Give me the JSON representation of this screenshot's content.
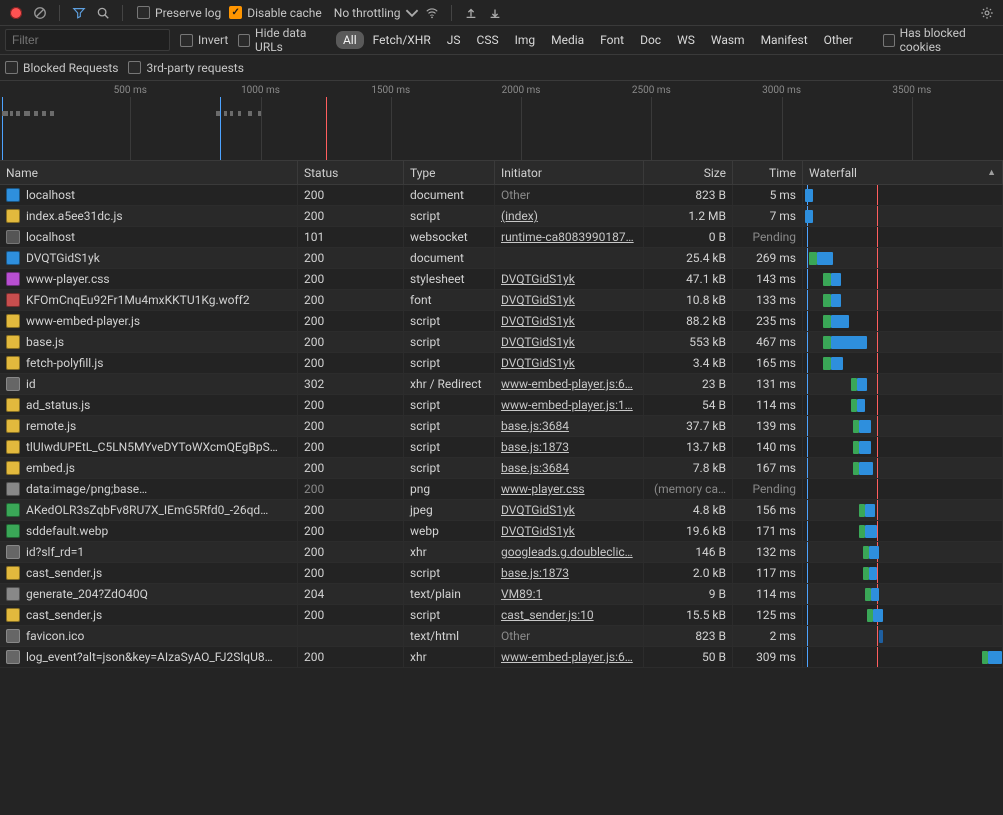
{
  "toolbar": {
    "preserve_log_label": "Preserve log",
    "disable_cache_label": "Disable cache",
    "throttling_label": "No throttling"
  },
  "filterbar": {
    "filter_placeholder": "Filter",
    "invert_label": "Invert",
    "hide_data_urls_label": "Hide data URLs",
    "categories": [
      "All",
      "Fetch/XHR",
      "JS",
      "CSS",
      "Img",
      "Media",
      "Font",
      "Doc",
      "WS",
      "Wasm",
      "Manifest",
      "Other"
    ],
    "has_blocked_cookies_label": "Has blocked cookies"
  },
  "filterbar2": {
    "blocked_requests_label": "Blocked Requests",
    "third_party_label": "3rd-party requests"
  },
  "timeline": {
    "ticks": [
      "500 ms",
      "1000 ms",
      "1500 ms",
      "2000 ms",
      "2500 ms",
      "3000 ms",
      "3500 ms"
    ]
  },
  "columns": {
    "name": "Name",
    "status": "Status",
    "type": "Type",
    "initiator": "Initiator",
    "size": "Size",
    "time": "Time",
    "waterfall": "Waterfall"
  },
  "rows": [
    {
      "icon": "doc",
      "name": "localhost",
      "status": "200",
      "type": "document",
      "initiator": "Other",
      "init_dim": true,
      "size": "823 B",
      "time": "5 ms",
      "wf": [
        {
          "l": 1,
          "w": 4,
          "c": "b"
        }
      ]
    },
    {
      "icon": "js",
      "name": "index.a5ee31dc.js",
      "status": "200",
      "type": "script",
      "initiator": "(index)",
      "size": "1.2 MB",
      "time": "7 ms",
      "wf": [
        {
          "l": 1,
          "w": 4,
          "c": "b"
        }
      ]
    },
    {
      "icon": "ws",
      "name": "localhost",
      "status": "101",
      "type": "websocket",
      "initiator": "runtime-ca8083990187…",
      "size": "0 B",
      "time": "Pending",
      "wf": []
    },
    {
      "icon": "doc",
      "name": "DVQTGidS1yk",
      "status": "200",
      "type": "document",
      "initiator": "",
      "init_dim": true,
      "size": "25.4 kB",
      "time": "269 ms",
      "wf": [
        {
          "l": 3,
          "w": 4,
          "c": "g"
        },
        {
          "l": 7,
          "w": 8,
          "c": "b"
        }
      ]
    },
    {
      "icon": "css",
      "name": "www-player.css",
      "status": "200",
      "type": "stylesheet",
      "initiator": "DVQTGidS1yk",
      "size": "47.1 kB",
      "time": "143 ms",
      "wf": [
        {
          "l": 10,
          "w": 4,
          "c": "g"
        },
        {
          "l": 14,
          "w": 5,
          "c": "b"
        }
      ]
    },
    {
      "icon": "font",
      "name": "KFOmCnqEu92Fr1Mu4mxKKTU1Kg.woff2",
      "status": "200",
      "type": "font",
      "initiator": "DVQTGidS1yk",
      "size": "10.8 kB",
      "time": "133 ms",
      "wf": [
        {
          "l": 10,
          "w": 4,
          "c": "g"
        },
        {
          "l": 14,
          "w": 5,
          "c": "b"
        }
      ]
    },
    {
      "icon": "js",
      "name": "www-embed-player.js",
      "status": "200",
      "type": "script",
      "initiator": "DVQTGidS1yk",
      "size": "88.2 kB",
      "time": "235 ms",
      "wf": [
        {
          "l": 10,
          "w": 4,
          "c": "g"
        },
        {
          "l": 14,
          "w": 9,
          "c": "b"
        }
      ]
    },
    {
      "icon": "js",
      "name": "base.js",
      "status": "200",
      "type": "script",
      "initiator": "DVQTGidS1yk",
      "size": "553 kB",
      "time": "467 ms",
      "wf": [
        {
          "l": 10,
          "w": 4,
          "c": "g"
        },
        {
          "l": 14,
          "w": 18,
          "c": "b"
        }
      ]
    },
    {
      "icon": "js",
      "name": "fetch-polyfill.js",
      "status": "200",
      "type": "script",
      "initiator": "DVQTGidS1yk",
      "size": "3.4 kB",
      "time": "165 ms",
      "wf": [
        {
          "l": 10,
          "w": 4,
          "c": "g"
        },
        {
          "l": 14,
          "w": 6,
          "c": "b"
        }
      ]
    },
    {
      "icon": "xhr",
      "name": "id",
      "status": "302",
      "type": "xhr / Redirect",
      "initiator": "www-embed-player.js:6…",
      "size": "23 B",
      "time": "131 ms",
      "wf": [
        {
          "l": 24,
          "w": 3,
          "c": "g"
        },
        {
          "l": 27,
          "w": 5,
          "c": "b"
        }
      ]
    },
    {
      "icon": "js",
      "name": "ad_status.js",
      "status": "200",
      "type": "script",
      "initiator": "www-embed-player.js:1…",
      "size": "54 B",
      "time": "114 ms",
      "wf": [
        {
          "l": 24,
          "w": 3,
          "c": "g"
        },
        {
          "l": 27,
          "w": 4,
          "c": "b"
        }
      ]
    },
    {
      "icon": "js",
      "name": "remote.js",
      "status": "200",
      "type": "script",
      "initiator": "base.js:3684",
      "size": "37.7 kB",
      "time": "139 ms",
      "wf": [
        {
          "l": 25,
          "w": 3,
          "c": "g"
        },
        {
          "l": 28,
          "w": 6,
          "c": "b"
        }
      ]
    },
    {
      "icon": "js",
      "name": "tlUIwdUPEtL_C5LN5MYveDYToWXcmQEgBpS…",
      "status": "200",
      "type": "script",
      "initiator": "base.js:1873",
      "size": "13.7 kB",
      "time": "140 ms",
      "wf": [
        {
          "l": 25,
          "w": 3,
          "c": "g"
        },
        {
          "l": 28,
          "w": 6,
          "c": "b"
        }
      ]
    },
    {
      "icon": "js",
      "name": "embed.js",
      "status": "200",
      "type": "script",
      "initiator": "base.js:3684",
      "size": "7.8 kB",
      "time": "167 ms",
      "wf": [
        {
          "l": 25,
          "w": 3,
          "c": "g"
        },
        {
          "l": 28,
          "w": 7,
          "c": "b"
        }
      ]
    },
    {
      "icon": "txt",
      "name": "data:image/png;base…",
      "status": "200",
      "status_dim": true,
      "type": "png",
      "initiator": "www-player.css",
      "size": "(memory ca…",
      "time": "Pending",
      "wf": []
    },
    {
      "icon": "img",
      "name": "AKedOLR3sZqbFv8RU7X_IEmG5Rfd0_-26qd…",
      "status": "200",
      "type": "jpeg",
      "initiator": "DVQTGidS1yk",
      "size": "4.8 kB",
      "time": "156 ms",
      "wf": [
        {
          "l": 28,
          "w": 3,
          "c": "g"
        },
        {
          "l": 31,
          "w": 5,
          "c": "b"
        }
      ]
    },
    {
      "icon": "img",
      "name": "sddefault.webp",
      "status": "200",
      "type": "webp",
      "initiator": "DVQTGidS1yk",
      "size": "19.6 kB",
      "time": "171 ms",
      "wf": [
        {
          "l": 28,
          "w": 3,
          "c": "g"
        },
        {
          "l": 31,
          "w": 6,
          "c": "b"
        }
      ]
    },
    {
      "icon": "xhr",
      "name": "id?slf_rd=1",
      "status": "200",
      "type": "xhr",
      "initiator": "googleads.g.doubleclic…",
      "size": "146 B",
      "time": "132 ms",
      "wf": [
        {
          "l": 30,
          "w": 3,
          "c": "g"
        },
        {
          "l": 33,
          "w": 5,
          "c": "b"
        }
      ]
    },
    {
      "icon": "js",
      "name": "cast_sender.js",
      "status": "200",
      "type": "script",
      "initiator": "base.js:1873",
      "size": "2.0 kB",
      "time": "117 ms",
      "wf": [
        {
          "l": 30,
          "w": 3,
          "c": "g"
        },
        {
          "l": 33,
          "w": 4,
          "c": "b"
        }
      ]
    },
    {
      "icon": "txt",
      "name": "generate_204?ZdO40Q",
      "status": "204",
      "type": "text/plain",
      "initiator": "VM89:1",
      "size": "9 B",
      "time": "114 ms",
      "wf": [
        {
          "l": 31,
          "w": 3,
          "c": "g"
        },
        {
          "l": 34,
          "w": 4,
          "c": "b"
        }
      ]
    },
    {
      "icon": "js",
      "name": "cast_sender.js",
      "status": "200",
      "type": "script",
      "initiator": "cast_sender.js:10",
      "size": "15.5 kB",
      "time": "125 ms",
      "wf": [
        {
          "l": 32,
          "w": 3,
          "c": "g"
        },
        {
          "l": 35,
          "w": 5,
          "c": "b"
        }
      ]
    },
    {
      "icon": "xhr",
      "name": "favicon.ico",
      "status": "",
      "type": "text/html",
      "initiator": "Other",
      "init_dim": true,
      "size": "823 B",
      "time": "2 ms",
      "wf": [
        {
          "l": 38,
          "w": 2,
          "c": "db"
        }
      ]
    },
    {
      "icon": "xhr",
      "name": "log_event?alt=json&key=AIzaSyAO_FJ2SlqU8…",
      "status": "200",
      "type": "xhr",
      "initiator": "www-embed-player.js:6…",
      "size": "50 B",
      "time": "309 ms",
      "wf": [
        {
          "l": 90,
          "w": 3,
          "c": "g"
        },
        {
          "l": 93,
          "w": 7,
          "c": "b"
        }
      ]
    }
  ],
  "waterfall_lines": {
    "blue": 2,
    "red": 37
  }
}
